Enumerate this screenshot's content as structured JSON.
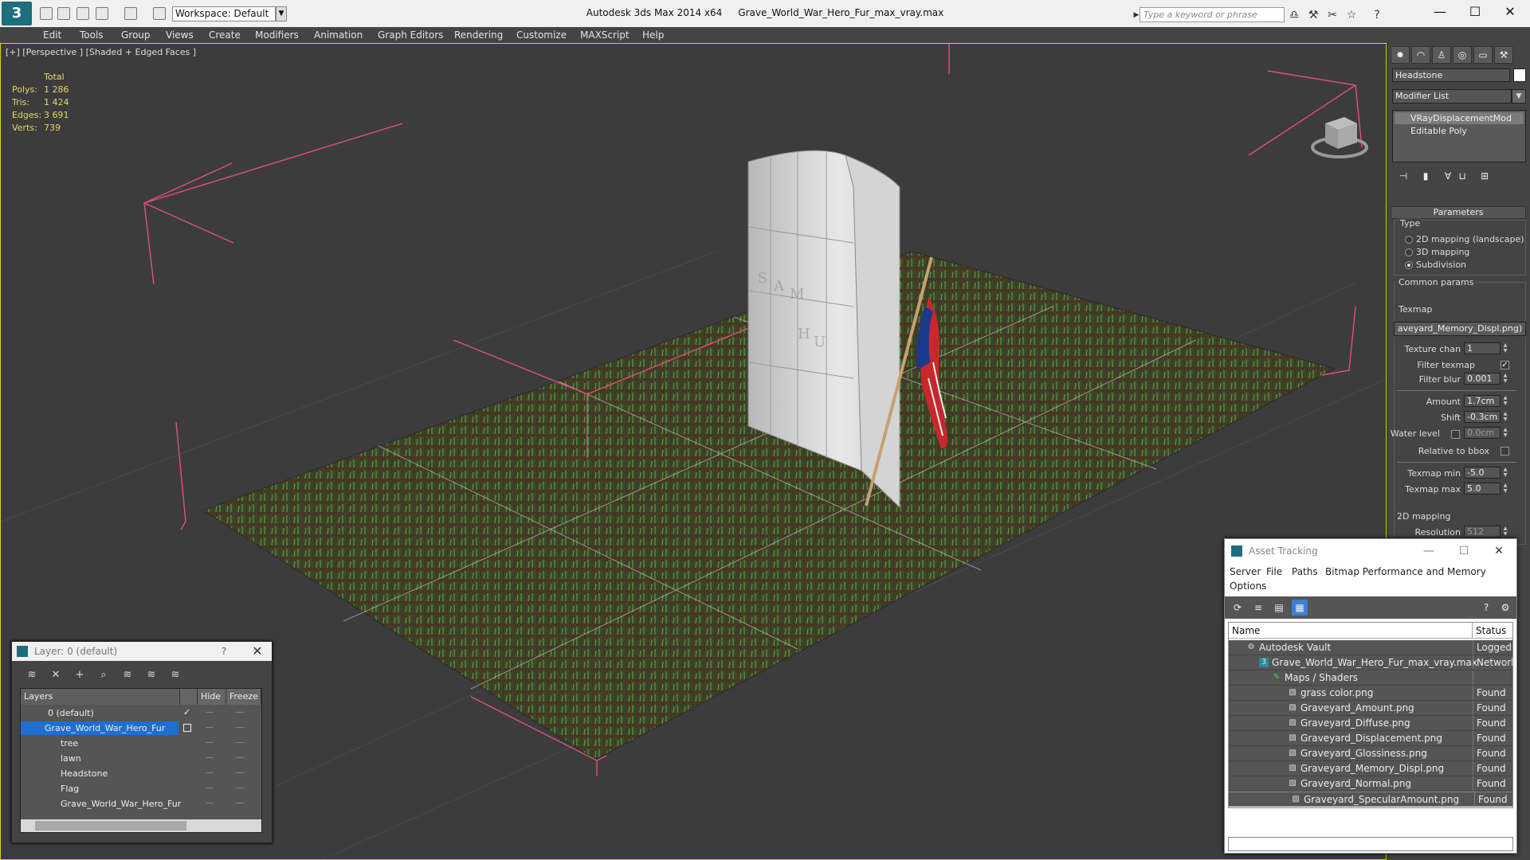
{
  "titlebar": {
    "workspace": "Workspace: Default",
    "app_name": "Autodesk 3ds Max  2014 x64",
    "file_name": "Grave_World_War_Hero_Fur_max_vray.max",
    "search_placeholder": "Type a keyword or phrase"
  },
  "menu": [
    "Edit",
    "Tools",
    "Group",
    "Views",
    "Create",
    "Modifiers",
    "Animation",
    "Graph Editors",
    "Rendering",
    "Customize",
    "MAXScript",
    "Help"
  ],
  "viewport": {
    "label": "[+] [Perspective ] [Shaded + Edged Faces ]",
    "stats_header": "Total",
    "stats": [
      {
        "key": "Polys:",
        "value": "1 286"
      },
      {
        "key": "Tris:",
        "value": "1 424"
      },
      {
        "key": "Edges:",
        "value": "3 691"
      },
      {
        "key": "Verts:",
        "value": "739"
      }
    ]
  },
  "command_panel": {
    "object_name": "Headstone",
    "modifier_list": "Modifier List",
    "stack": [
      "VRayDisplacementMod",
      "Editable Poly"
    ],
    "rollout": "Parameters",
    "type_group": "Type",
    "type_options": [
      {
        "label": "2D mapping (landscape)",
        "selected": false
      },
      {
        "label": "3D mapping",
        "selected": false
      },
      {
        "label": "Subdivision",
        "selected": true
      }
    ],
    "common_group": "Common params",
    "texmap_label": "Texmap",
    "texmap_value": "aveyard_Memory_Displ.png)",
    "texture_chan_label": "Texture chan",
    "texture_chan": "1",
    "filter_texmap_label": "Filter texmap",
    "filter_blur_label": "Filter blur",
    "filter_blur": "0.001",
    "amount_label": "Amount",
    "amount": "1.7cm",
    "shift_label": "Shift",
    "shift": "-0.3cm",
    "water_level_label": "Water level",
    "water_level": "0.0cm",
    "relative_bbox_label": "Relative to bbox",
    "texmap_min_label": "Texmap min",
    "texmap_min": "-5.0",
    "texmap_max_label": "Texmap max",
    "texmap_max": "5.0",
    "mapping_group": "2D mapping",
    "resolution_label": "Resolution",
    "resolution": "512"
  },
  "layer_dialog": {
    "title": "Layer: 0 (default)",
    "help": "?",
    "col_layers": "Layers",
    "col_hide": "Hide",
    "col_freeze": "Freeze",
    "rows": [
      "0 (default)",
      "Grave_World_War_Hero_Fur",
      "tree",
      "lawn",
      "Headstone",
      "Flag",
      "Grave_World_War_Hero_Fur"
    ]
  },
  "asset_dialog": {
    "title": "Asset Tracking",
    "menu": [
      "Server",
      "File",
      "Paths",
      "Bitmap Performance and Memory",
      "Options"
    ],
    "col_name": "Name",
    "col_status": "Status",
    "rows": [
      {
        "name": "Autodesk Vault",
        "status": "Logged O"
      },
      {
        "name": "Grave_World_War_Hero_Fur_max_vray.max",
        "status": "Network"
      },
      {
        "name": "Maps / Shaders",
        "status": ""
      },
      {
        "name": "grass color.png",
        "status": "Found"
      },
      {
        "name": "Graveyard_Amount.png",
        "status": "Found"
      },
      {
        "name": "Graveyard_Diffuse.png",
        "status": "Found"
      },
      {
        "name": "Graveyard_Displacement.png",
        "status": "Found"
      },
      {
        "name": "Graveyard_Glossiness.png",
        "status": "Found"
      },
      {
        "name": "Graveyard_Memory_Displ.png",
        "status": "Found"
      },
      {
        "name": "Graveyard_Normal.png",
        "status": "Found"
      },
      {
        "name": "Graveyard_SpecularAmount.png",
        "status": "Found"
      }
    ]
  },
  "colors": {
    "viewport_bg": "#3c3c3c",
    "selection_bracket": "#e0507a",
    "stats_text": "#e9d66a",
    "layer_selected": "#1e6fd0"
  }
}
